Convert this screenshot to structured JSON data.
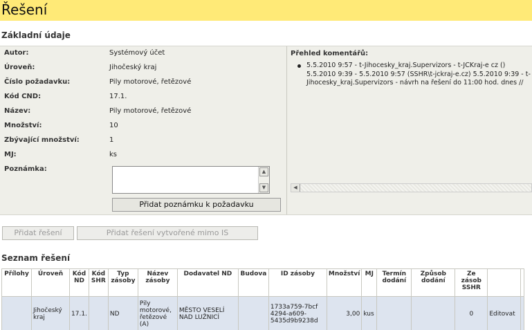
{
  "page": {
    "title": "Řešení"
  },
  "basic": {
    "heading": "Základní údaje",
    "fields": [
      {
        "label": "Autor:",
        "value": "Systémový účet"
      },
      {
        "label": "Úroveň:",
        "value": "Jihočeský kraj"
      },
      {
        "label": "Číslo požadavku:",
        "value": "Pily motorové, řetězové"
      },
      {
        "label": "Kód CND:",
        "value": "17.1."
      },
      {
        "label": "Název:",
        "value": "Pily motorové, řetězové"
      },
      {
        "label": "Množství:",
        "value": "10"
      },
      {
        "label": "Zbývající množství:",
        "value": "1"
      },
      {
        "label": "MJ:",
        "value": "ks"
      }
    ],
    "note_label": "Poznámka:",
    "add_note_button": "Přidat poznámku k požadavku"
  },
  "comments": {
    "heading": "Přehled komentářů:",
    "items": [
      "5.5.2010 9:57 - t-Jihocesky_kraj.Supervizors - t-JCKraj-e cz () 5.5.2010 9:39 - 5.5.2010 9:57 (SSHR\\t-jckraj-e.cz) 5.5.2010 9:39 - t-Jihocesky_kraj.Supervizors - návrh na řešení do 11:00 hod. dnes //"
    ]
  },
  "actions": {
    "add_solution": "Přidat řešení",
    "add_external_solution": "Přidat řešení vytvořené mimo IS"
  },
  "solutions": {
    "heading": "Seznam řešení",
    "columns": [
      "Přílohy",
      "Úroveň",
      "Kód ND",
      "Kód SHR",
      "Typ zásoby",
      "Název zásoby",
      "Dodavatel ND",
      "Budova",
      "ID zásoby",
      "Množství",
      "MJ",
      "Termín dodání",
      "Způsob dodání",
      "Ze zásob SSHR",
      "",
      ""
    ],
    "rows": [
      {
        "prilohy": "",
        "uroven": "Jihočeský kraj",
        "kod_nd": "17.1.",
        "kod_shr": "",
        "typ": "ND",
        "nazev": "Pily motorové, řetězové (A)",
        "dodavatel": "MĚSTO VESELÍ NAD LUŽNICÍ",
        "budova": "",
        "id": "1733a759-7bcf 4294-a609-5435d9b9238d",
        "mnozstvi": "3,00",
        "mj": "kus",
        "termin": "",
        "zpusob": "",
        "ze_zasob": "0",
        "action": "Editovat"
      }
    ]
  }
}
